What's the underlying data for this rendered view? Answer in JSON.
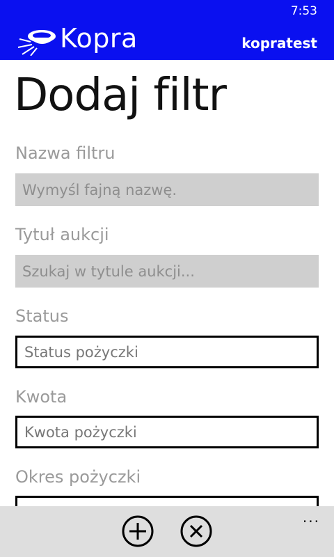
{
  "status_bar": {
    "time": "7:53"
  },
  "header": {
    "app_name": "Kopra",
    "user": "kopratest"
  },
  "page": {
    "title": "Dodaj filtr"
  },
  "form": {
    "filter_name": {
      "label": "Nazwa filtru",
      "placeholder": "Wymyśl fajną nazwę."
    },
    "auction_title": {
      "label": "Tytuł aukcji",
      "placeholder": "Szukaj w tytule aukcji..."
    },
    "status": {
      "label": "Status",
      "value": "Status pożyczki"
    },
    "amount": {
      "label": "Kwota",
      "value": "Kwota pożyczki"
    },
    "loan_period": {
      "label": "Okres pożyczki"
    }
  },
  "app_bar": {
    "more": "..."
  },
  "colors": {
    "accent": "#0a10f0",
    "app_bar": "#dedede",
    "input_gray": "#cfcfcf"
  }
}
